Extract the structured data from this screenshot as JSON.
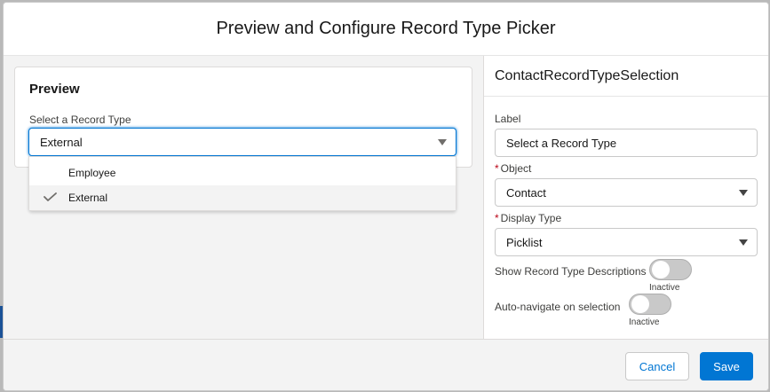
{
  "modal": {
    "title": "Preview and Configure Record Type Picker"
  },
  "preview": {
    "title": "Preview",
    "label": "Select a Record Type",
    "selected": "External",
    "options": [
      "Employee",
      "External"
    ]
  },
  "config": {
    "component_name": "ContactRecordTypeSelection",
    "label_field": {
      "label": "Label",
      "value": "Select a Record Type"
    },
    "object_field": {
      "required_mark": "*",
      "label": "Object",
      "value": "Contact"
    },
    "display_type_field": {
      "required_mark": "*",
      "label": "Display Type",
      "value": "Picklist"
    },
    "show_descriptions": {
      "label": "Show Record Type Descriptions",
      "state": "Inactive"
    },
    "auto_navigate": {
      "label": "Auto-navigate on selection",
      "state": "Inactive"
    }
  },
  "footer": {
    "cancel_label": "Cancel",
    "save_label": "Save"
  },
  "colors": {
    "brand": "#0176d3",
    "required": "#ba0517"
  }
}
